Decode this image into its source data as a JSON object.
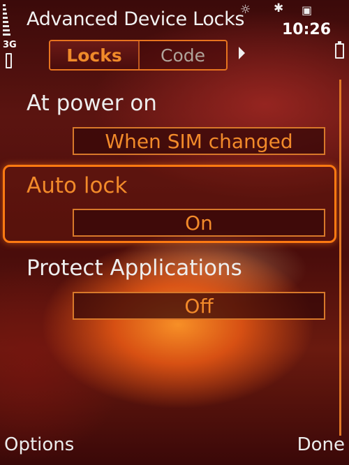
{
  "status": {
    "network": "3G",
    "time": "10:26"
  },
  "title": "Advanced Device Locks",
  "tabs": [
    {
      "label": "Locks",
      "active": true
    },
    {
      "label": "Code",
      "active": false
    }
  ],
  "settings": [
    {
      "label": "At power on",
      "value": "When SIM changed"
    },
    {
      "label": "Auto lock",
      "value": "On",
      "selected": true
    },
    {
      "label": "Protect Applications",
      "value": "Off"
    }
  ],
  "softkeys": {
    "left": "Options",
    "right": "Done"
  },
  "colors": {
    "accent": "#f28a2a",
    "highlight_border": "#ff7a12"
  }
}
